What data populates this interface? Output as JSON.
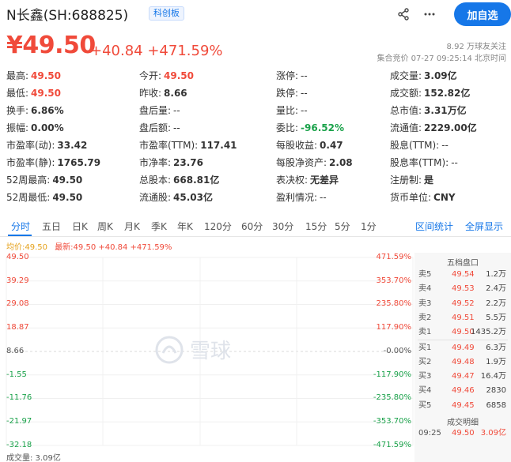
{
  "header": {
    "title": "N长鑫(SH:688825)",
    "badge": "科创板",
    "add_button": "加自选"
  },
  "quote": {
    "price": "¥49.50",
    "change": "+40.84 +471.59%",
    "followers": "8.92 万球友关注",
    "auction": "集合竞价 07-27 09:25:14 北京时间"
  },
  "stats": [
    [
      {
        "label": "最高:",
        "value": "49.50",
        "color": "red"
      },
      {
        "label": "今开:",
        "value": "49.50",
        "color": "red"
      },
      {
        "label": "涨停:",
        "value": "--",
        "color": "plain"
      },
      {
        "label": "成交量:",
        "value": "3.09亿",
        "color": "bold"
      }
    ],
    [
      {
        "label": "最低:",
        "value": "49.50",
        "color": "red"
      },
      {
        "label": "昨收:",
        "value": "8.66",
        "color": "bold"
      },
      {
        "label": "跌停:",
        "value": "--",
        "color": "plain"
      },
      {
        "label": "成交额:",
        "value": "152.82亿",
        "color": "bold"
      }
    ],
    [
      {
        "label": "换手:",
        "value": "6.86%",
        "color": "bold"
      },
      {
        "label": "盘后量:",
        "value": "--",
        "color": "plain"
      },
      {
        "label": "量比:",
        "value": "--",
        "color": "plain"
      },
      {
        "label": "总市值:",
        "value": "3.31万亿",
        "color": "bold"
      }
    ],
    [
      {
        "label": "振幅:",
        "value": "0.00%",
        "color": "bold"
      },
      {
        "label": "盘后额:",
        "value": "--",
        "color": "plain"
      },
      {
        "label": "委比:",
        "value": "-96.52%",
        "color": "green"
      },
      {
        "label": "流通值:",
        "value": "2229.00亿",
        "color": "bold"
      }
    ],
    [
      {
        "label": "市盈率(动):",
        "value": "33.42",
        "color": "bold"
      },
      {
        "label": "市盈率(TTM):",
        "value": "117.41",
        "color": "bold"
      },
      {
        "label": "每股收益:",
        "value": "0.47",
        "color": "bold"
      },
      {
        "label": "股息(TTM):",
        "value": "--",
        "color": "plain"
      }
    ],
    [
      {
        "label": "市盈率(静):",
        "value": "1765.79",
        "color": "bold"
      },
      {
        "label": "市净率:",
        "value": "23.76",
        "color": "bold"
      },
      {
        "label": "每股净资产:",
        "value": "2.08",
        "color": "bold"
      },
      {
        "label": "股息率(TTM):",
        "value": "--",
        "color": "plain"
      }
    ],
    [
      {
        "label": "52周最高:",
        "value": "49.50",
        "color": "bold"
      },
      {
        "label": "总股本:",
        "value": "668.81亿",
        "color": "bold"
      },
      {
        "label": "表决权:",
        "value": "无差异",
        "color": "bold"
      },
      {
        "label": "注册制:",
        "value": "是",
        "color": "bold"
      }
    ],
    [
      {
        "label": "52周最低:",
        "value": "49.50",
        "color": "bold"
      },
      {
        "label": "流通股:",
        "value": "45.03亿",
        "color": "bold"
      },
      {
        "label": "盈利情况:",
        "value": "--",
        "color": "plain"
      },
      {
        "label": "货币单位:",
        "value": "CNY",
        "color": "bold"
      }
    ]
  ],
  "tabs": [
    "分时",
    "五日",
    "日K",
    "周K",
    "月K",
    "季K",
    "年K",
    "120分",
    "60分",
    "30分",
    "15分",
    "5分",
    "1分"
  ],
  "tab_links": [
    "区间统计",
    "全屏显示"
  ],
  "chart": {
    "avg_label": "均价:49.50",
    "latest_label": "最新:49.50 +40.84 +471.59%",
    "left_axis": [
      "49.50",
      "39.29",
      "29.08",
      "18.87",
      "8.66",
      "-1.55",
      "-11.76",
      "-21.97",
      "-32.18"
    ],
    "right_axis": [
      "471.59%",
      "353.70%",
      "235.80%",
      "117.90%",
      "-0.00%",
      "-117.90%",
      "-235.80%",
      "-353.70%",
      "-471.59%"
    ],
    "volume_label": "成交量: 3.09亿",
    "watermark": "雪球"
  },
  "orderbook": {
    "title": "五档盘口",
    "asks": [
      {
        "name": "卖5",
        "price": "49.54",
        "vol": "1.2万"
      },
      {
        "name": "卖4",
        "price": "49.53",
        "vol": "2.4万"
      },
      {
        "name": "卖3",
        "price": "49.52",
        "vol": "2.2万"
      },
      {
        "name": "卖2",
        "price": "49.51",
        "vol": "5.5万"
      },
      {
        "name": "卖1",
        "price": "49.50",
        "vol": "1435.2万"
      }
    ],
    "bids": [
      {
        "name": "买1",
        "price": "49.49",
        "vol": "6.3万"
      },
      {
        "name": "买2",
        "price": "49.48",
        "vol": "1.9万"
      },
      {
        "name": "买3",
        "price": "49.47",
        "vol": "16.4万"
      },
      {
        "name": "买4",
        "price": "49.46",
        "vol": "2830"
      },
      {
        "name": "买5",
        "price": "49.45",
        "vol": "6858"
      }
    ],
    "detail_title": "成交明细",
    "trades": [
      {
        "time": "09:25",
        "price": "49.50",
        "vol": "3.09亿"
      }
    ]
  },
  "colors": {
    "up": "#f04a3a",
    "down": "#1aa24a",
    "accent": "#1677e8"
  }
}
